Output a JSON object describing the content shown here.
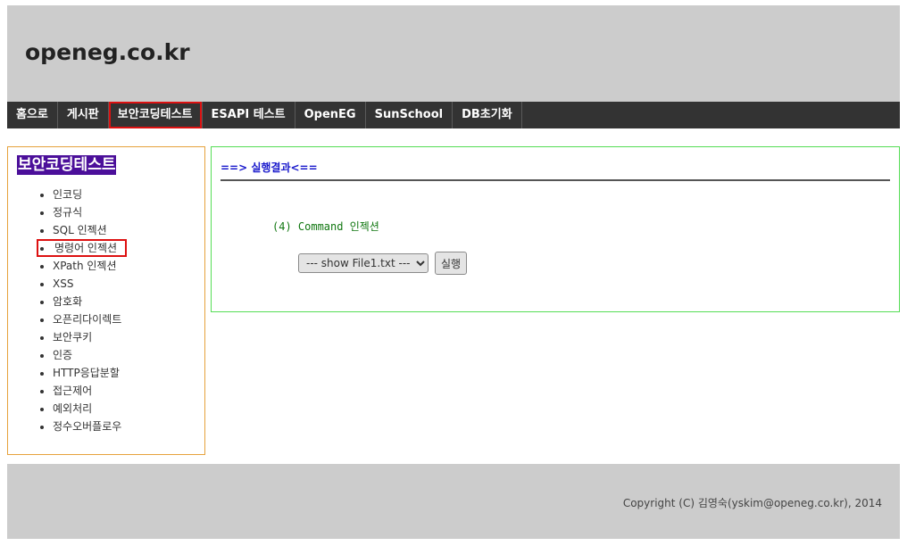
{
  "header": {
    "title": "openeg.co.kr"
  },
  "nav": {
    "items": [
      {
        "label": "홈으로"
      },
      {
        "label": "게시판"
      },
      {
        "label": "보안코딩테스트"
      },
      {
        "label": "ESAPI 테스트"
      },
      {
        "label": "OpenEG"
      },
      {
        "label": "SunSchool"
      },
      {
        "label": "DB초기화"
      }
    ],
    "active_index": 2
  },
  "sidebar": {
    "title": "보안코딩테스트",
    "items": [
      {
        "label": "인코딩"
      },
      {
        "label": "정규식"
      },
      {
        "label": "SQL 인젝션"
      },
      {
        "label": "명령어 인젝션"
      },
      {
        "label": "XPath 인젝션"
      },
      {
        "label": "XSS"
      },
      {
        "label": "암호화"
      },
      {
        "label": "오픈리다이렉트"
      },
      {
        "label": "보안쿠키"
      },
      {
        "label": "인증"
      },
      {
        "label": "HTTP응답분할"
      },
      {
        "label": "접근제어"
      },
      {
        "label": "예외처리"
      },
      {
        "label": "정수오버플로우"
      }
    ],
    "selected_index": 3
  },
  "content": {
    "result_title": "==> 실행결과<==",
    "section_label": "(4) Command 인젝션",
    "select": {
      "selected": "--- show File1.txt ---"
    },
    "run_label": "실행"
  },
  "footer": {
    "copyright": "Copyright (C) 김영숙(yskim@openeg.co.kr), 2014"
  },
  "colors": {
    "header_bg": "#cccccc",
    "nav_bg": "#333333",
    "active_outline": "#dd1111",
    "sidebar_border": "#e6a23c",
    "sidebar_title_bg": "#4b0f9a",
    "content_border": "#55dd55",
    "result_title": "#1a1acc",
    "section_label": "#117711"
  }
}
